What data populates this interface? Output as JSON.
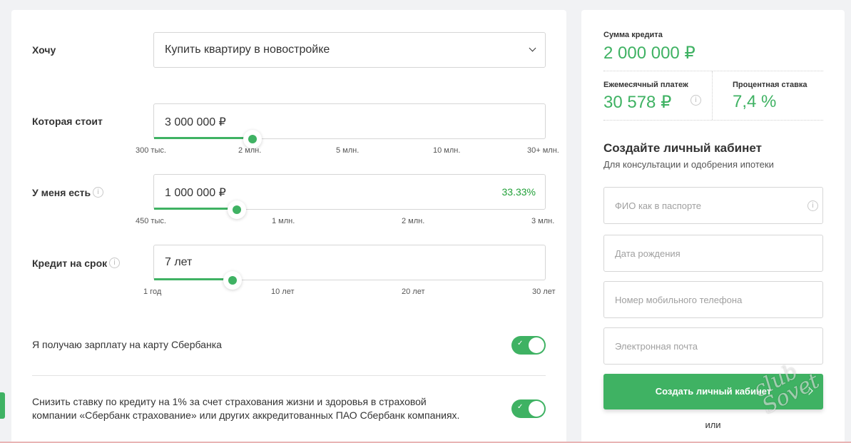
{
  "calculator": {
    "want_label": "Хочу",
    "want_value": "Купить квартиру в новостройке",
    "price_label": "Которая стоит",
    "price_value": "3 000 000 ₽",
    "price_fraction": 0.25,
    "price_ticks": [
      "300 тыс.",
      "2 млн.",
      "5 млн.",
      "10 млн.",
      "30+ млн."
    ],
    "own_label": "У меня есть",
    "own_value": "1 000 000 ₽",
    "own_percent": "33.33%",
    "own_fraction": 0.21,
    "own_ticks": [
      "450 тыс.",
      "1 млн.",
      "2 млн.",
      "3 млн."
    ],
    "term_label": "Кредит на срок",
    "term_value": "7 лет",
    "term_fraction": 0.2,
    "term_ticks": [
      "1 год",
      "10 лет",
      "20 лет",
      "30 лет"
    ],
    "salary_text": "Я получаю зарплату на карту Сбербанка",
    "salary_toggle": true,
    "insurance_text_1": "Снизить ставку по кредиту на 1% за счет страхования жизни и здоровья в страховой",
    "insurance_text_2": "компании «Сбербанк страхование» или других аккредитованных ПАО Сбербанк компаниях.",
    "insurance_toggle": true
  },
  "summary": {
    "loan_amount_label": "Сумма кредита",
    "loan_amount_value": "2 000 000 ₽",
    "monthly_label": "Ежемесячный платеж",
    "monthly_value": "30 578 ₽",
    "rate_label": "Процентная ставка",
    "rate_value": "7,4 %"
  },
  "signup": {
    "title": "Создайте личный кабинет",
    "subtitle": "Для консультации и одобрения ипотеки",
    "name_placeholder": "ФИО как в паспорте",
    "birth_placeholder": "Дата рождения",
    "phone_placeholder": "Номер мобильного телефона",
    "email_placeholder": "Электронная почта",
    "submit_label": "Создать личный кабинет",
    "or_text": "или"
  },
  "icons": {
    "info": "info-icon",
    "chevron": "chevron-down-icon",
    "check": "check-icon",
    "arrow": "chevron-right-icon"
  },
  "colors": {
    "accent": "#3fb263",
    "percent": "#21a038"
  }
}
